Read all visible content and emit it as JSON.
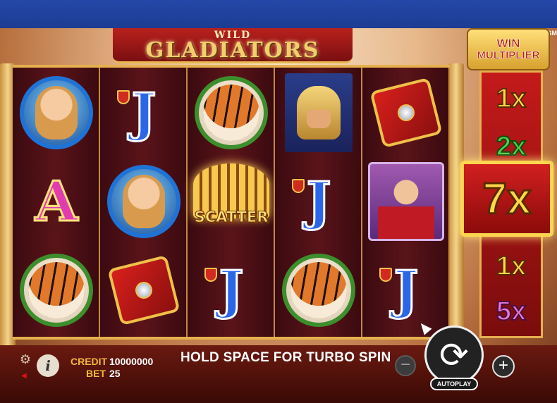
{
  "game": {
    "logo_wild": "WILD",
    "logo_title": "GLADIATORS",
    "provider": "PRAGM"
  },
  "reels": [
    [
      "woman-medallion",
      "letter-a",
      "tiger-medallion"
    ],
    [
      "letter-j",
      "woman-medallion",
      "shield"
    ],
    [
      "tiger-medallion",
      "scatter",
      "letter-j"
    ],
    [
      "gladiator-helmet",
      "letter-j",
      "tiger-medallion"
    ],
    [
      "shield",
      "caesar",
      "letter-j"
    ]
  ],
  "symbols": {
    "letter_a": "A",
    "letter_j": "J",
    "scatter_label": "SCATTER"
  },
  "multiplier": {
    "header_win": "WIN",
    "header_word": "MULTIPLIER",
    "values": [
      "1x",
      "2x",
      "1x",
      "5x"
    ],
    "active": "7x"
  },
  "controls": {
    "credit_label": "CREDIT",
    "credit_value": "10000000",
    "bet_label": "BET",
    "bet_value": "25",
    "message": "HOLD SPACE FOR TURBO SPIN",
    "minus": "−",
    "plus": "+",
    "spin": "⟳",
    "autoplay": "AUTOPLAY",
    "info": "i",
    "settings": "⚙"
  }
}
